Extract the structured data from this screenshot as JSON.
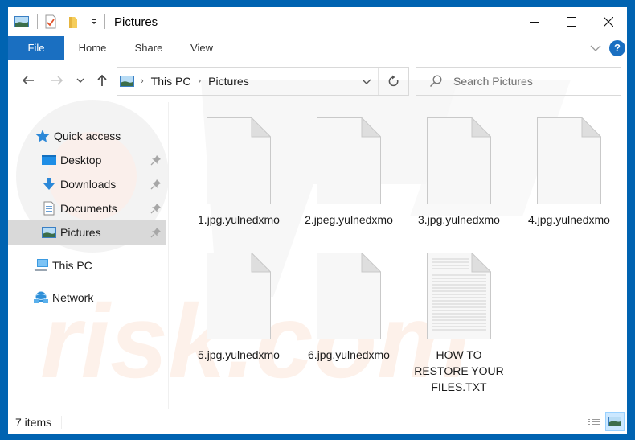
{
  "window": {
    "title": "Pictures"
  },
  "quick_access_toolbar": {
    "items": [
      "pictures-icon",
      "properties-icon",
      "new-folder-icon",
      "customize-dropdown-icon"
    ]
  },
  "window_controls": {
    "minimize": "minimize-icon",
    "maximize": "maximize-icon",
    "close": "close-icon"
  },
  "ribbon": {
    "tabs": [
      {
        "label": "File",
        "active": true
      },
      {
        "label": "Home"
      },
      {
        "label": "Share"
      },
      {
        "label": "View"
      }
    ],
    "help_label": "?",
    "accent": "#1a6fc1"
  },
  "navigation": {
    "back": "back-arrow-icon",
    "forward": "forward-arrow-icon",
    "recent": "recent-locations-icon",
    "up": "up-arrow-icon"
  },
  "address_bar": {
    "breadcrumbs": [
      "This PC",
      "Pictures"
    ],
    "separator": "›"
  },
  "search": {
    "placeholder": "Search Pictures"
  },
  "nav_pane": {
    "items": [
      {
        "label": "Quick access",
        "icon": "star-icon"
      },
      {
        "label": "Desktop",
        "icon": "desktop-icon",
        "pinned": true
      },
      {
        "label": "Downloads",
        "icon": "downloads-icon",
        "pinned": true
      },
      {
        "label": "Documents",
        "icon": "documents-icon",
        "pinned": true
      },
      {
        "label": "Pictures",
        "icon": "pictures-icon",
        "pinned": true,
        "selected": true
      },
      {
        "label": "This PC",
        "icon": "computer-icon"
      },
      {
        "label": "Network",
        "icon": "network-icon"
      }
    ]
  },
  "files": [
    {
      "name": "1.jpg.yulnedxmo",
      "type": "blank"
    },
    {
      "name": "2.jpeg.yulnedxmo",
      "type": "blank"
    },
    {
      "name": "3.jpg.yulnedxmo",
      "type": "blank"
    },
    {
      "name": "4.jpg.yulnedxmo",
      "type": "blank"
    },
    {
      "name": "5.jpg.yulnedxmo",
      "type": "blank"
    },
    {
      "name": "6.jpg.yulnedxmo",
      "type": "blank"
    },
    {
      "name": "HOW TO RESTORE YOUR FILES.TXT",
      "type": "text"
    }
  ],
  "status_bar": {
    "item_count": "7 items",
    "views": [
      {
        "name": "details-view",
        "active": false
      },
      {
        "name": "large-icons-view",
        "active": true
      }
    ]
  }
}
